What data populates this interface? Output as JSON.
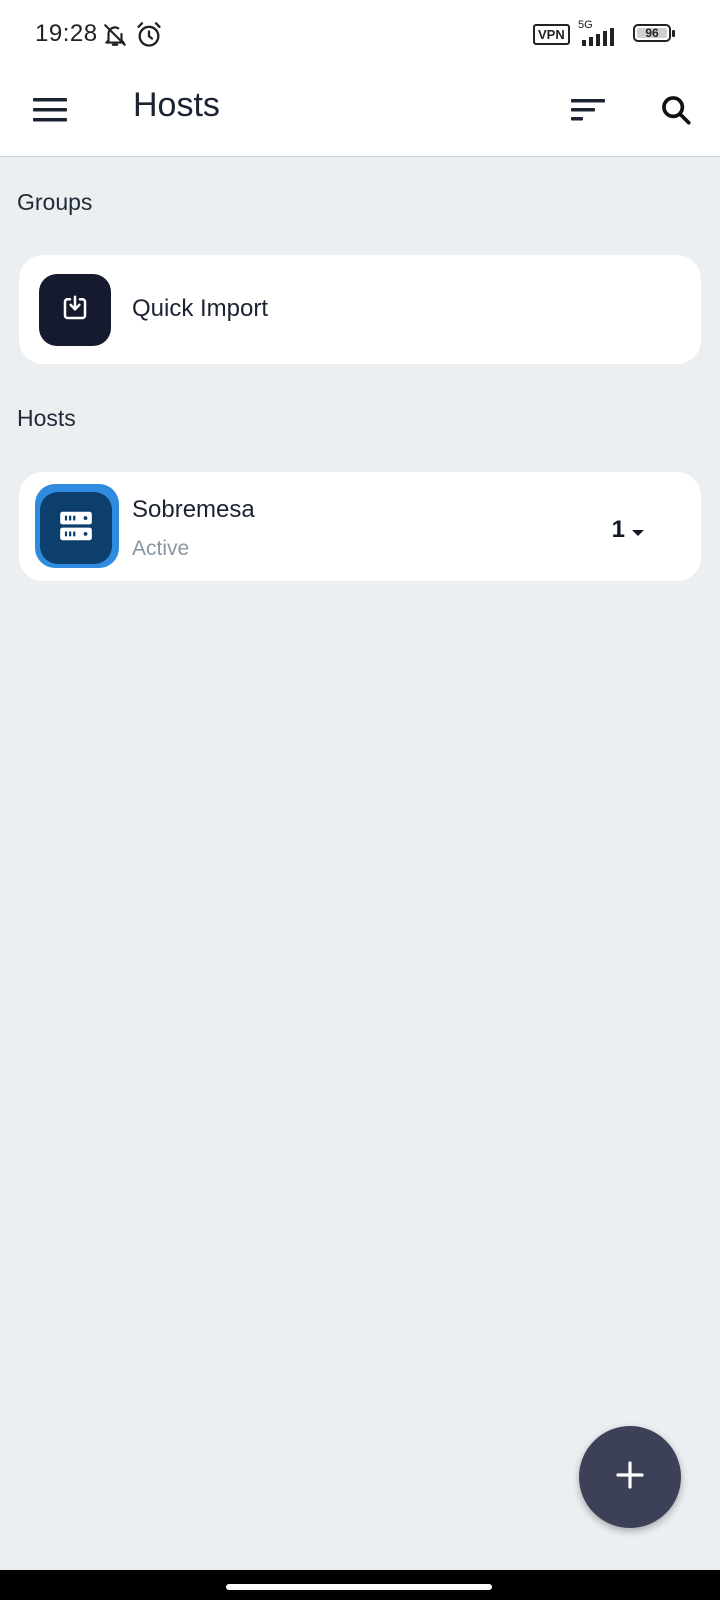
{
  "status_bar": {
    "time": "19:28",
    "vpn_label": "VPN",
    "network_label": "5G",
    "battery_level": "96",
    "icons": [
      "bell-off-icon",
      "alarm-icon",
      "vpn-icon",
      "signal-icon",
      "battery-icon"
    ]
  },
  "app_bar": {
    "title": "Hosts",
    "icons": [
      "menu-icon",
      "sort-icon",
      "search-icon"
    ]
  },
  "groups": {
    "heading": "Groups",
    "items": [
      {
        "label": "Quick Import",
        "icon": "import-icon"
      }
    ]
  },
  "hosts": {
    "heading": "Hosts",
    "items": [
      {
        "name": "Sobremesa",
        "status": "Active",
        "count": "1",
        "icon": "server-icon"
      }
    ]
  },
  "fab": {
    "icon": "plus-icon"
  },
  "colors": {
    "background": "#ECEFF1",
    "card": "#FFFFFF",
    "import_tile": "#151A2E",
    "host_tile": "#0D3F6D",
    "host_accent": "#2F8BE0",
    "fab": "#3C4158",
    "muted_text": "#8A97A3"
  }
}
